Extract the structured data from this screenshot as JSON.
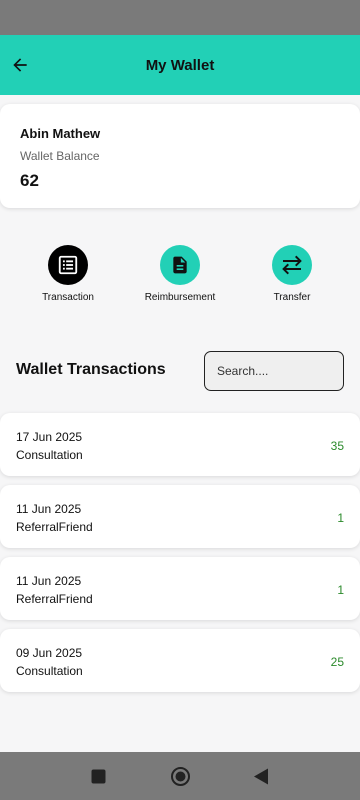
{
  "header": {
    "title": "My Wallet",
    "back_icon": "arrow-left-icon"
  },
  "balance_card": {
    "user_name": "Abin Mathew",
    "balance_label": "Wallet Balance",
    "balance_value": "62"
  },
  "actions": [
    {
      "label": "Transaction",
      "icon": "list-icon",
      "color": "#000000"
    },
    {
      "label": "Reimbursement",
      "icon": "document-icon",
      "color": "#22d0b6"
    },
    {
      "label": "Transfer",
      "icon": "swap-arrows-icon",
      "color": "#22d0b6"
    }
  ],
  "transactions_section": {
    "title": "Wallet Transactions",
    "search_placeholder": "Search...."
  },
  "transactions": [
    {
      "date": "17 Jun 2025",
      "type": "Consultation",
      "amount": "35"
    },
    {
      "date": "11 Jun 2025",
      "type": "ReferralFriend",
      "amount": "1"
    },
    {
      "date": "11 Jun 2025",
      "type": "ReferralFriend",
      "amount": "1"
    },
    {
      "date": "09 Jun 2025",
      "type": "Consultation",
      "amount": "25"
    }
  ],
  "colors": {
    "accent": "#22d0b6",
    "amount_positive": "#2b8a2b",
    "system_bars": "#7a7a7a"
  },
  "system_nav": {
    "icons": [
      "recent-apps-icon",
      "home-icon",
      "back-triangle-icon"
    ]
  }
}
